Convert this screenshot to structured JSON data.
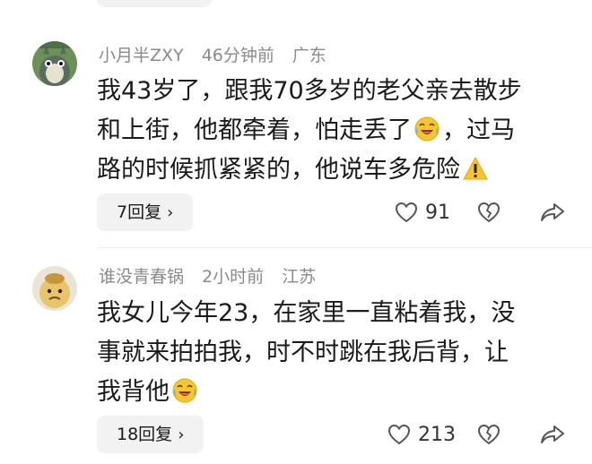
{
  "comments": [
    {
      "username": "小月半ZXY",
      "time": "46分钟前",
      "location": "广东",
      "lines": [
        "我43岁了，跟我70多岁的老父亲去散步",
        "和上街，他都牵着，怕走丢了",
        "，过马",
        "路的时候抓紧紧的，他说车多危险"
      ],
      "reply_label": "7回复",
      "like_count": "91"
    },
    {
      "username": "谁没青春锅",
      "time": "2小时前",
      "location": "江苏",
      "lines": [
        "我女儿今年23，在家里一直粘着我，没",
        "事就来拍拍我，时不时跳在我后背，让",
        "我背他"
      ],
      "reply_label": "18回复",
      "like_count": "213"
    }
  ],
  "icons": {
    "reply_chevron": "chevron-right-icon",
    "like": "heart-icon",
    "dislike": "broken-heart-icon",
    "share": "share-icon",
    "laugh_cry": "laugh-cry-emoji",
    "warning": "warning-emoji"
  },
  "colors": {
    "meta_text": "#8a8a8a",
    "reply_bg": "#f2f2f2",
    "emoji_yellow": "#f7c531"
  }
}
